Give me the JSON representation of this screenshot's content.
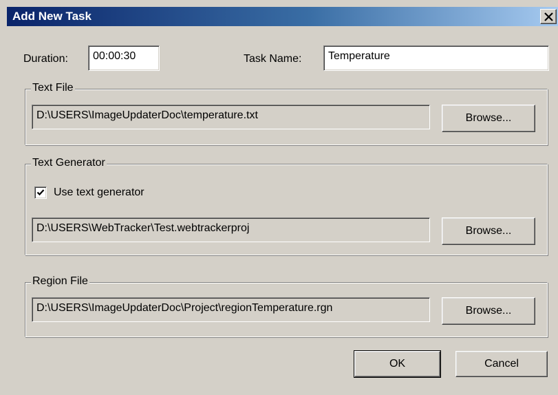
{
  "dialog": {
    "title": "Add New Task",
    "close_icon": "close-icon"
  },
  "duration": {
    "label": "Duration:",
    "value": "00:00:30"
  },
  "task_name": {
    "label": "Task Name:",
    "value": "Temperature"
  },
  "text_file": {
    "group_label": "Text File",
    "path": "D:\\USERS\\ImageUpdaterDoc\\temperature.txt",
    "browse_label": "Browse..."
  },
  "text_generator": {
    "group_label": "Text Generator",
    "checkbox_label": "Use text generator",
    "checked": true,
    "path": "D:\\USERS\\WebTracker\\Test.webtrackerproj",
    "browse_label": "Browse..."
  },
  "region_file": {
    "group_label": "Region File",
    "path": "D:\\USERS\\ImageUpdaterDoc\\Project\\regionTemperature.rgn",
    "browse_label": "Browse..."
  },
  "actions": {
    "ok_label": "OK",
    "cancel_label": "Cancel"
  },
  "colors": {
    "titlebar_start": "#0a246a",
    "titlebar_end": "#a6caf0",
    "face": "#d4d0c8"
  }
}
